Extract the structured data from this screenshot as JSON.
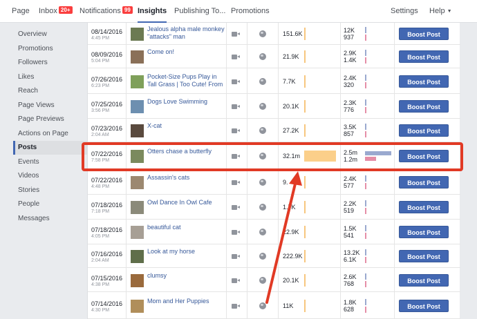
{
  "nav": {
    "page": "Page",
    "inbox": "Inbox",
    "inbox_badge": "20+",
    "notifications": "Notifications",
    "notifications_badge": "99",
    "insights": "Insights",
    "publishing": "Publishing To...",
    "promotions": "Promotions",
    "settings": "Settings",
    "help": "Help"
  },
  "sidebar": {
    "items": [
      {
        "label": "Overview"
      },
      {
        "label": "Promotions"
      },
      {
        "label": "Followers"
      },
      {
        "label": "Likes"
      },
      {
        "label": "Reach"
      },
      {
        "label": "Page Views"
      },
      {
        "label": "Page Previews"
      },
      {
        "label": "Actions on Page"
      },
      {
        "label": "Posts"
      },
      {
        "label": "Events"
      },
      {
        "label": "Videos"
      },
      {
        "label": "Stories"
      },
      {
        "label": "People"
      },
      {
        "label": "Messages"
      }
    ],
    "active_index": 8
  },
  "posts": [
    {
      "date": "08/14/2016",
      "time": "4:45 PM",
      "title": "Jealous alpha male monkey \"attacks\" man",
      "reach": "151.6K",
      "eng1": "12K",
      "eng2": "937",
      "boost": "Boost Post"
    },
    {
      "date": "08/09/2016",
      "time": "5:04 PM",
      "title": "Come on!",
      "reach": "21.9K",
      "eng1": "2.9K",
      "eng2": "1.4K",
      "boost": "Boost Post"
    },
    {
      "date": "07/26/2016",
      "time": "6:23 PM",
      "title": "Pocket-Size Pups Play in Tall Grass | Too Cute! From",
      "reach": "7.7K",
      "eng1": "2.4K",
      "eng2": "320",
      "boost": "Boost Post"
    },
    {
      "date": "07/25/2016",
      "time": "3:56 PM",
      "title": "Dogs Love Swimming",
      "reach": "20.1K",
      "eng1": "2.3K",
      "eng2": "776",
      "boost": "Boost Post"
    },
    {
      "date": "07/23/2016",
      "time": "2:04 AM",
      "title": "X-cat",
      "reach": "27.2K",
      "eng1": "3.5K",
      "eng2": "857",
      "boost": "Boost Post"
    },
    {
      "date": "07/22/2016",
      "time": "7:58 PM",
      "title": "Otters chase a butterfly",
      "reach": "32.1m",
      "eng1": "2.5m",
      "eng2": "1.2m",
      "boost": "Boost Post"
    },
    {
      "date": "07/22/2016",
      "time": "4:48 PM",
      "title": "Assassin's cats",
      "reach": "9.",
      "eng1": "2.4K",
      "eng2": "577",
      "boost": "Boost Post"
    },
    {
      "date": "07/18/2016",
      "time": "7:18 PM",
      "title": "Owl Dance In Owl Cafe",
      "reach": "1.7K",
      "eng1": "2.2K",
      "eng2": "519",
      "boost": "Boost Post"
    },
    {
      "date": "07/18/2016",
      "time": "4:05 PM",
      "title": "beautiful cat",
      "reach": "22.9K",
      "eng1": "1.5K",
      "eng2": "541",
      "boost": "Boost Post"
    },
    {
      "date": "07/16/2016",
      "time": "2:04 AM",
      "title": "Look at my horse",
      "reach": "222.9K",
      "eng1": "13.2K",
      "eng2": "6.1K",
      "boost": "Boost Post"
    },
    {
      "date": "07/15/2016",
      "time": "4:38 PM",
      "title": "clumsy",
      "reach": "20.1K",
      "eng1": "2.6K",
      "eng2": "768",
      "boost": "Boost Post"
    },
    {
      "date": "07/14/2016",
      "time": "4:30 PM",
      "title": "Mom and Her Puppies",
      "reach": "11K",
      "eng1": "1.8K",
      "eng2": "628",
      "boost": "Boost Post"
    }
  ],
  "thumb_colors": [
    "#6b7a52",
    "#8a7058",
    "#7fa05a",
    "#6d8fb0",
    "#5a4a3e",
    "#7b8a5e",
    "#9c8870",
    "#8b8a7a",
    "#a79f95",
    "#5f6e4a",
    "#9a6a3c",
    "#b08e5a"
  ],
  "highlight_color": "#e13a25",
  "accent_color": "#4267b2"
}
